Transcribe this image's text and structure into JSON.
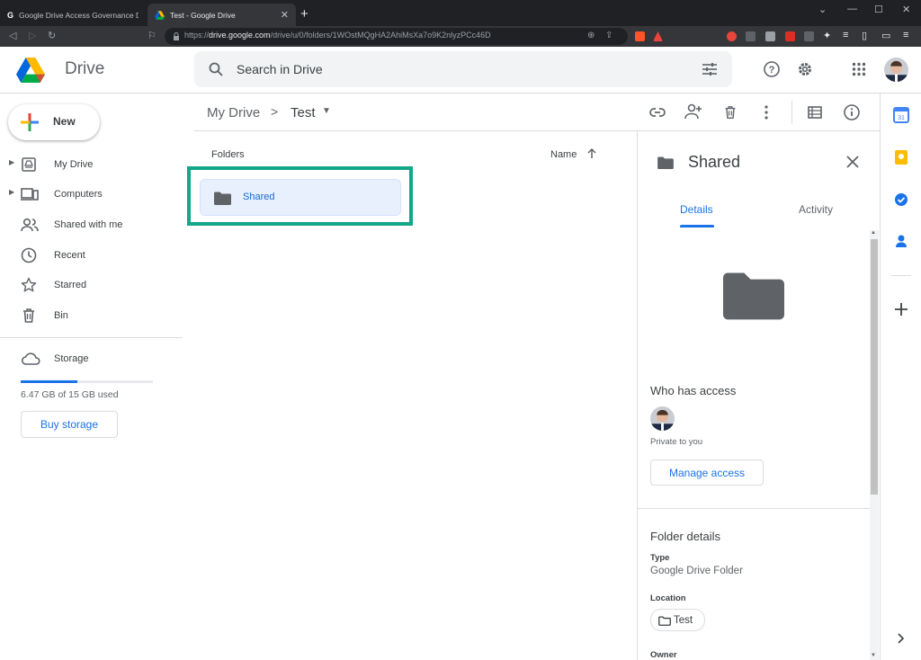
{
  "browser": {
    "tabs": [
      {
        "title": "Google Drive Access Governance Don",
        "active": false
      },
      {
        "title": "Test - Google Drive",
        "active": true
      }
    ],
    "url_prefix": "https://",
    "url_host": "drive.google.com",
    "url_path": "/drive/u/0/folders/1WOstMQgHA2AhiMsXa7o9K2nlyzPCc46D"
  },
  "app": {
    "brand": "Drive",
    "search_placeholder": "Search in Drive"
  },
  "sidebar": {
    "new_label": "New",
    "items": [
      {
        "label": "My Drive",
        "icon": "my-drive-icon"
      },
      {
        "label": "Computers",
        "icon": "computers-icon"
      },
      {
        "label": "Shared with me",
        "icon": "shared-with-me-icon"
      },
      {
        "label": "Recent",
        "icon": "clock-icon"
      },
      {
        "label": "Starred",
        "icon": "star-icon"
      },
      {
        "label": "Bin",
        "icon": "trash-icon"
      },
      {
        "label": "Storage",
        "icon": "cloud-icon"
      }
    ],
    "storage_used_fraction": 0.43,
    "storage_text": "6.47 GB of 15 GB used",
    "buy_storage": "Buy storage"
  },
  "main": {
    "breadcrumb_root": "My Drive",
    "breadcrumb_chevron": ">",
    "breadcrumb_current": "Test",
    "folders_label": "Folders",
    "sort_label": "Name",
    "folders": [
      {
        "name": "Shared"
      }
    ]
  },
  "details": {
    "title": "Shared",
    "tab_details": "Details",
    "tab_activity": "Activity",
    "who_has_access": "Who has access",
    "private_text": "Private to you",
    "manage_access": "Manage access",
    "folder_details": "Folder details",
    "type_key": "Type",
    "type_value": "Google Drive Folder",
    "location_key": "Location",
    "location_value": "Test",
    "owner_key": "Owner"
  },
  "colors": {
    "accent": "#1a73e8",
    "highlight": "#13a688"
  }
}
